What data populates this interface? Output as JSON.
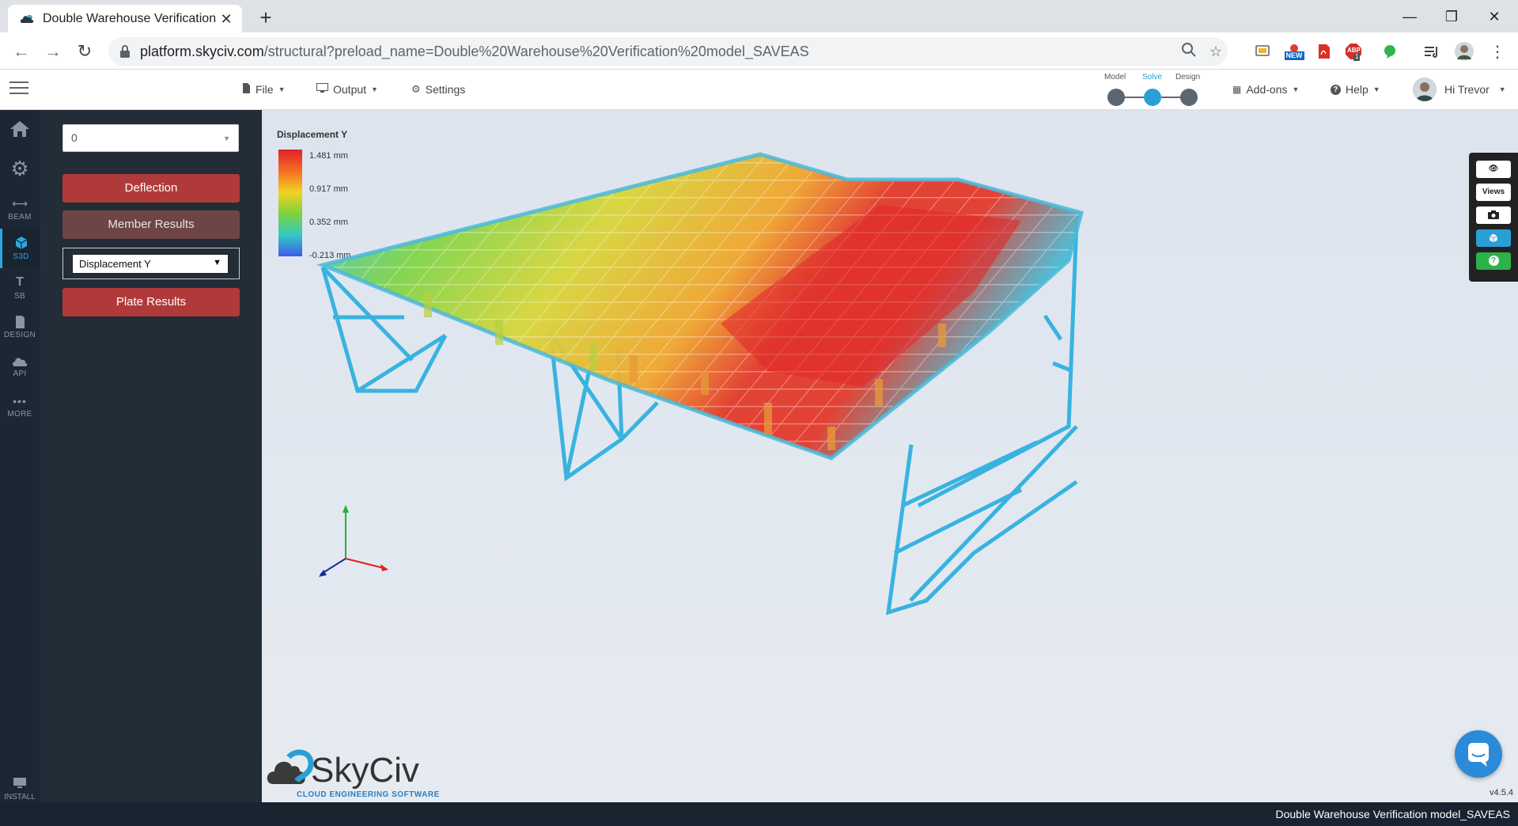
{
  "browser": {
    "tab_title": "Double Warehouse Verification n",
    "url_host": "platform.skyciv.com",
    "url_path": "/structural?preload_name=Double%20Warehouse%20Verification%20model_SAVEAS",
    "extension_new_badge": "NEW",
    "extension_abp_label": "ABP",
    "extension_abp_count": "1"
  },
  "header": {
    "menus": [
      {
        "label": "File"
      },
      {
        "label": "Output"
      },
      {
        "label": "Settings"
      }
    ],
    "workflow": {
      "model_label": "Model",
      "solve_label": "Solve",
      "design_label": "Design"
    },
    "addons_label": "Add-ons",
    "help_label": "Help",
    "user_greeting": "Hi Trevor"
  },
  "iconbar": {
    "items": [
      {
        "label": ""
      },
      {
        "label": ""
      },
      {
        "label": "BEAM"
      },
      {
        "label": "S3D"
      },
      {
        "label": "SB"
      },
      {
        "label": "DESIGN"
      },
      {
        "label": "API"
      },
      {
        "label": "MORE"
      }
    ],
    "install_label": "INSTALL"
  },
  "panel": {
    "load_case_value": "0",
    "deflection_label": "Deflection",
    "member_results_label": "Member Results",
    "result_type_value": "Displacement Y",
    "plate_results_label": "Plate Results"
  },
  "viewport": {
    "legend_title": "Displacement Y",
    "legend_values": [
      "1.481 mm",
      "0.917 mm",
      "0.352 mm",
      "-0.213 mm"
    ],
    "logo_name": "SkyCiv",
    "logo_tagline": "CLOUD ENGINEERING SOFTWARE",
    "version": "v4.5.4"
  },
  "right_tools": {
    "views_label": "Views"
  },
  "statusbar": {
    "model_name": "Double Warehouse Verification model_SAVEAS"
  }
}
